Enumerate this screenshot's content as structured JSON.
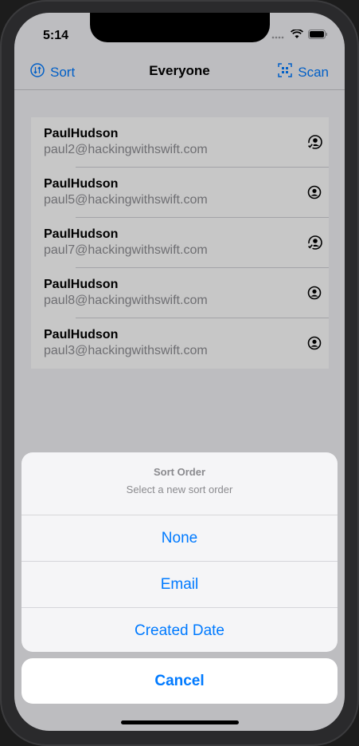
{
  "status": {
    "time": "5:14"
  },
  "nav": {
    "sort_label": "Sort",
    "title": "Everyone",
    "scan_label": "Scan"
  },
  "contacts": [
    {
      "name": "PaulHudson",
      "email": "paul2@hackingwithswift.com",
      "icon": "person-checkmark-icon"
    },
    {
      "name": "PaulHudson",
      "email": "paul5@hackingwithswift.com",
      "icon": "person-circle-icon"
    },
    {
      "name": "PaulHudson",
      "email": "paul7@hackingwithswift.com",
      "icon": "person-checkmark-icon"
    },
    {
      "name": "PaulHudson",
      "email": "paul8@hackingwithswift.com",
      "icon": "person-circle-icon"
    },
    {
      "name": "PaulHudson",
      "email": "paul3@hackingwithswift.com",
      "icon": "person-circle-icon"
    }
  ],
  "sheet": {
    "title": "Sort Order",
    "message": "Select a new sort order",
    "options": [
      "None",
      "Email",
      "Created Date"
    ],
    "cancel": "Cancel"
  },
  "colors": {
    "accent": "#007aff"
  }
}
